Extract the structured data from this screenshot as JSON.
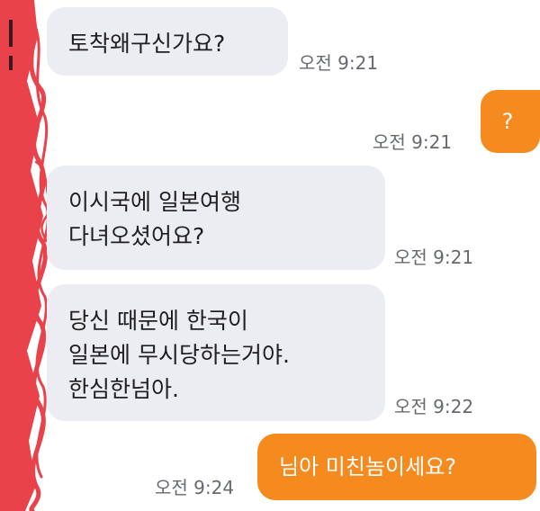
{
  "messages": [
    {
      "id": "m1",
      "side": "incoming",
      "text": "토착왜구신가요?",
      "time": "오전 9:21"
    },
    {
      "id": "m2",
      "side": "outgoing",
      "text": "?",
      "time": "오전 9:21"
    },
    {
      "id": "m3",
      "side": "incoming",
      "text": "이시국에 일본여행\n다녀오셨어요?",
      "time": "오전 9:21"
    },
    {
      "id": "m4",
      "side": "incoming",
      "text": "당신 때문에 한국이\n일본에 무시당하는거야.\n한심한넘아.",
      "time": "오전 9:22"
    },
    {
      "id": "m5",
      "side": "outgoing",
      "text": "님아 미친놈이세요?",
      "time": "오전 9:24"
    }
  ],
  "colors": {
    "incoming_bubble": "#ecedf2",
    "outgoing_bubble": "#f58a1f",
    "censor_scribble": "#e8333c"
  }
}
